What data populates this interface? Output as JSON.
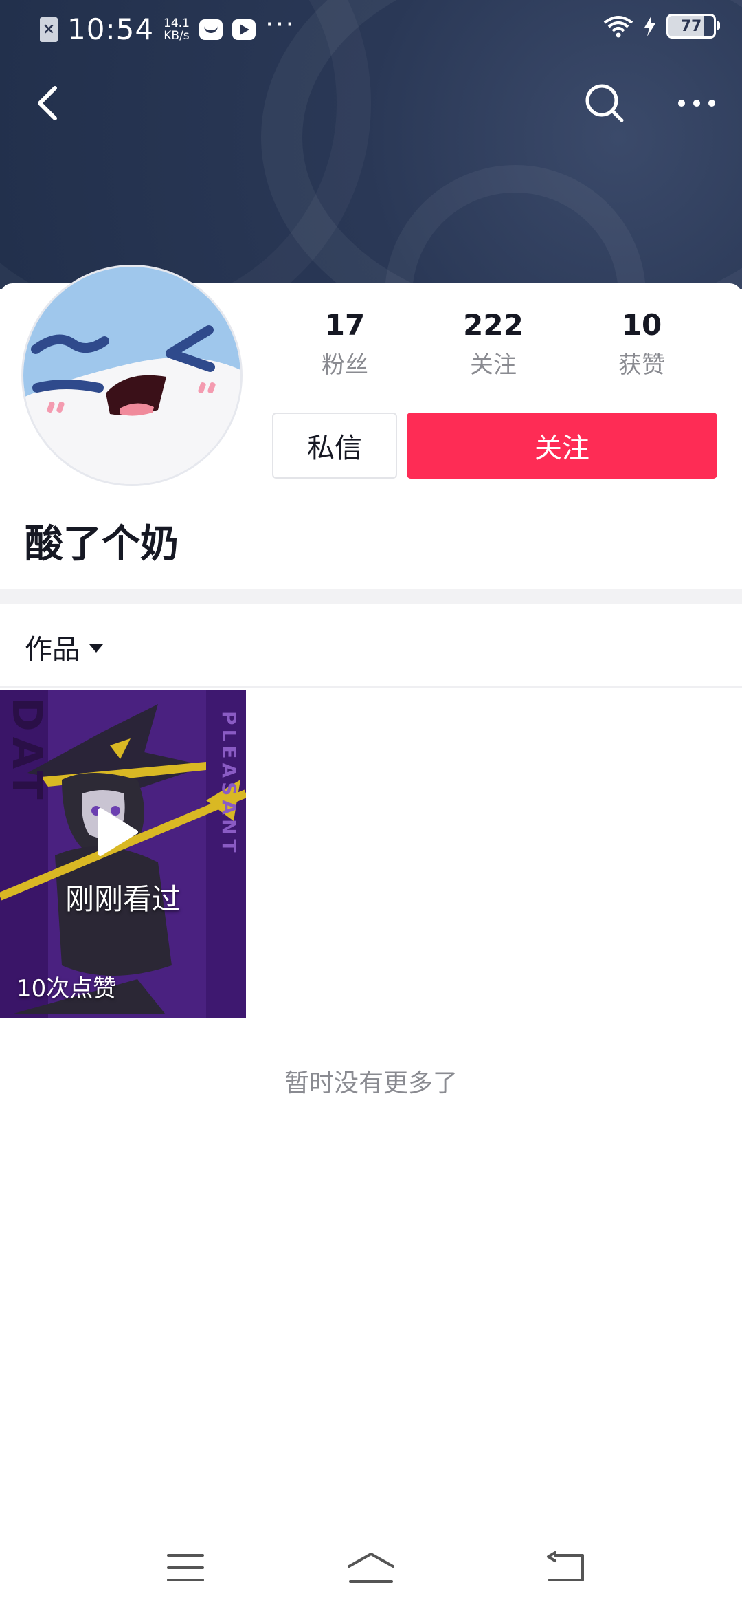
{
  "status_bar": {
    "time": "10:54",
    "speed_value": "14.1",
    "speed_unit": "KB/s",
    "battery": "77",
    "icons": [
      "close-notify-icon",
      "mail-icon",
      "play-icon",
      "more-dots-icon",
      "wifi-icon",
      "charging-icon",
      "battery-icon"
    ]
  },
  "nav": {
    "icons": [
      "back-icon",
      "search-icon",
      "more-icon"
    ]
  },
  "profile": {
    "stats": [
      {
        "value": "17",
        "label": "粉丝"
      },
      {
        "value": "222",
        "label": "关注"
      },
      {
        "value": "10",
        "label": "获赞"
      }
    ],
    "message_button": "私信",
    "follow_button": "关注",
    "nickname": "酸了个奶"
  },
  "works": {
    "tab_label": "作品",
    "items": [
      {
        "overlay": "刚刚看过",
        "likes": "10次点赞"
      }
    ],
    "end_text": "暂时没有更多了"
  },
  "colors": {
    "accent": "#fe2c55",
    "banner": "#2a3856"
  }
}
